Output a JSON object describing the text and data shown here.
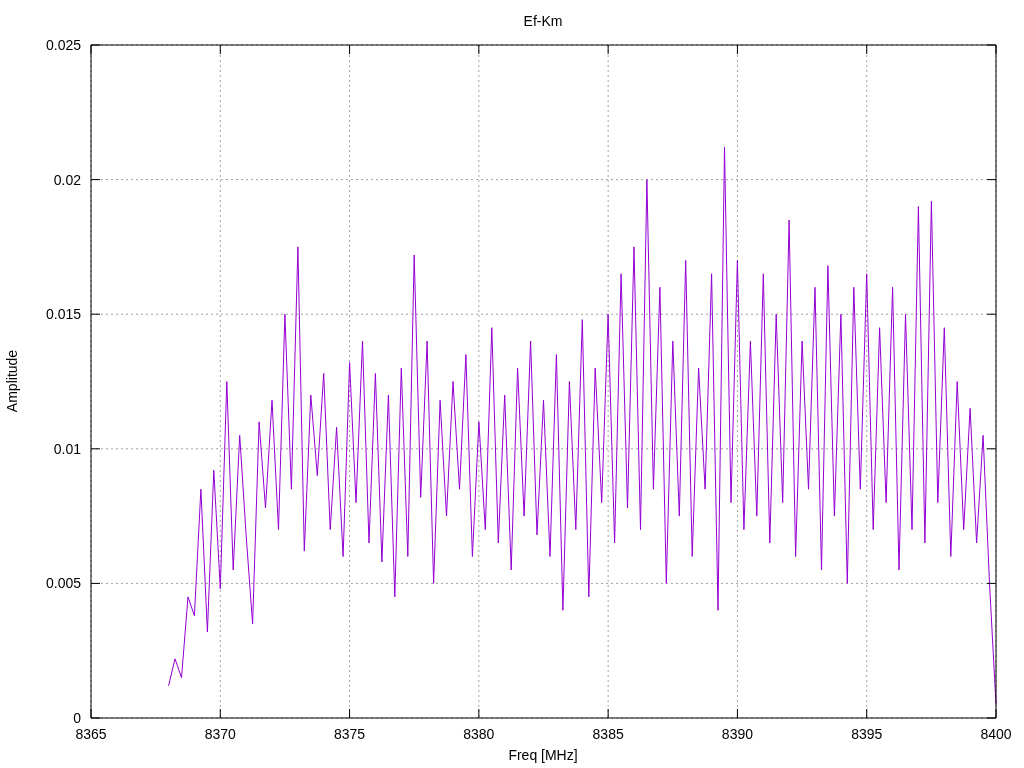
{
  "chart_data": {
    "type": "line",
    "title": "Ef-Km",
    "xlabel": "Freq [MHz]",
    "ylabel": "Amplitude",
    "xlim": [
      8365,
      8400
    ],
    "ylim": [
      0,
      0.025
    ],
    "xticks": [
      8365,
      8370,
      8375,
      8380,
      8385,
      8390,
      8395,
      8400
    ],
    "yticks": [
      {
        "value": 0,
        "label": "0"
      },
      {
        "value": 0.005,
        "label": "0.005"
      },
      {
        "value": 0.01,
        "label": "0.01"
      },
      {
        "value": 0.015,
        "label": "0.015"
      },
      {
        "value": 0.02,
        "label": "0.02"
      },
      {
        "value": 0.025,
        "label": "0.025"
      }
    ],
    "x": [
      8368,
      8368.25,
      8368.5,
      8368.75,
      8369,
      8369.25,
      8369.5,
      8369.75,
      8370,
      8370.25,
      8370.5,
      8370.75,
      8371,
      8371.25,
      8371.5,
      8371.75,
      8372,
      8372.25,
      8372.5,
      8372.75,
      8373,
      8373.25,
      8373.5,
      8373.75,
      8374,
      8374.25,
      8374.5,
      8374.75,
      8375,
      8375.25,
      8375.5,
      8375.75,
      8376,
      8376.25,
      8376.5,
      8376.75,
      8377,
      8377.25,
      8377.5,
      8377.75,
      8378,
      8378.25,
      8378.5,
      8378.75,
      8379,
      8379.25,
      8379.5,
      8379.75,
      8380,
      8380.25,
      8380.5,
      8380.75,
      8381,
      8381.25,
      8381.5,
      8381.75,
      8382,
      8382.25,
      8382.5,
      8382.75,
      8383,
      8383.25,
      8383.5,
      8383.75,
      8384,
      8384.25,
      8384.5,
      8384.75,
      8385,
      8385.25,
      8385.5,
      8385.75,
      8386,
      8386.25,
      8386.5,
      8386.75,
      8387,
      8387.25,
      8387.5,
      8387.75,
      8388,
      8388.25,
      8388.5,
      8388.75,
      8389,
      8389.25,
      8389.5,
      8389.75,
      8390,
      8390.25,
      8390.5,
      8390.75,
      8391,
      8391.25,
      8391.5,
      8391.75,
      8392,
      8392.25,
      8392.5,
      8392.75,
      8393,
      8393.25,
      8393.5,
      8393.75,
      8394,
      8394.25,
      8394.5,
      8394.75,
      8395,
      8395.25,
      8395.5,
      8395.75,
      8396,
      8396.25,
      8396.5,
      8396.75,
      8397,
      8397.25,
      8397.5,
      8397.75,
      8398,
      8398.25,
      8398.5,
      8398.75,
      8399,
      8399.25,
      8399.5,
      8399.75,
      8400
    ],
    "grid": true,
    "series": [
      {
        "color": "#9400d3",
        "values": [
          0.0012,
          0.0022,
          0.0015,
          0.0045,
          0.0038,
          0.0085,
          0.0032,
          0.0092,
          0.0048,
          0.0125,
          0.0055,
          0.0105,
          0.0068,
          0.0035,
          0.011,
          0.0078,
          0.0118,
          0.007,
          0.015,
          0.0085,
          0.0175,
          0.0062,
          0.012,
          0.009,
          0.0128,
          0.007,
          0.0108,
          0.006,
          0.0132,
          0.008,
          0.014,
          0.0065,
          0.0128,
          0.0058,
          0.012,
          0.0045,
          0.013,
          0.006,
          0.0172,
          0.0082,
          0.014,
          0.005,
          0.0118,
          0.0075,
          0.0125,
          0.0085,
          0.0135,
          0.006,
          0.011,
          0.007,
          0.0145,
          0.0065,
          0.012,
          0.0055,
          0.013,
          0.0075,
          0.014,
          0.0068,
          0.0118,
          0.006,
          0.0135,
          0.004,
          0.0125,
          0.007,
          0.0148,
          0.0045,
          0.013,
          0.008,
          0.015,
          0.0065,
          0.0165,
          0.0078,
          0.0175,
          0.007,
          0.02,
          0.0085,
          0.016,
          0.005,
          0.014,
          0.0075,
          0.017,
          0.006,
          0.013,
          0.0085,
          0.0165,
          0.004,
          0.0212,
          0.008,
          0.017,
          0.007,
          0.014,
          0.0075,
          0.0165,
          0.0065,
          0.015,
          0.008,
          0.0185,
          0.006,
          0.014,
          0.0085,
          0.016,
          0.0055,
          0.0168,
          0.0075,
          0.015,
          0.005,
          0.016,
          0.0085,
          0.0165,
          0.007,
          0.0145,
          0.008,
          0.016,
          0.0055,
          0.015,
          0.007,
          0.019,
          0.0065,
          0.0192,
          0.008,
          0.0145,
          0.006,
          0.0125,
          0.007,
          0.0115,
          0.0065,
          0.0105,
          0.005,
          0.0005
        ]
      }
    ]
  }
}
